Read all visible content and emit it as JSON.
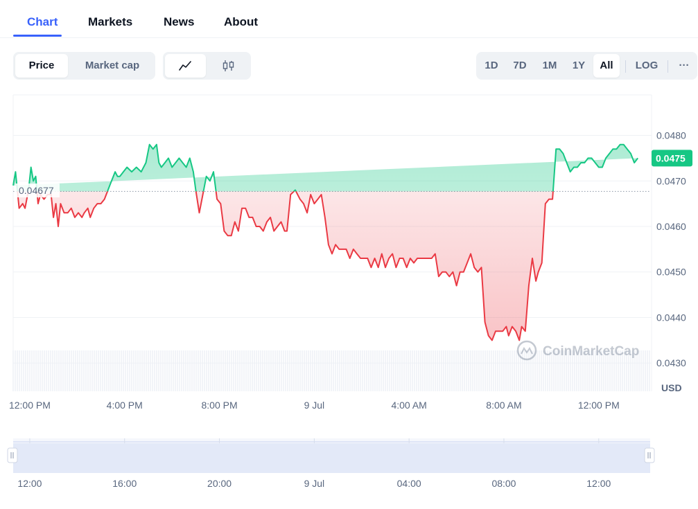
{
  "tabs": [
    {
      "label": "Chart",
      "active": true
    },
    {
      "label": "Markets",
      "active": false
    },
    {
      "label": "News",
      "active": false
    },
    {
      "label": "About",
      "active": false
    }
  ],
  "controls": {
    "metric": {
      "price": "Price",
      "market_cap": "Market cap",
      "selected": "Price"
    },
    "chart_style": {
      "line_icon": "line-chart-icon",
      "candle_icon": "candlestick-icon",
      "selected": "line"
    },
    "ranges": [
      "1D",
      "7D",
      "1M",
      "1Y",
      "All"
    ],
    "selected_range": "All",
    "log_label": "LOG",
    "more_label": "···"
  },
  "colors": {
    "up": "#16c784",
    "down": "#ea3943",
    "accent": "#3861fb"
  },
  "watermark": "CoinMarketCap",
  "currency": "USD",
  "chart_data": {
    "type": "line",
    "baseline_label": "0.04677",
    "baseline": 0.04677,
    "current_price_label": "0.0475",
    "y_ticks": [
      "0.0480",
      "0.0470",
      "0.0460",
      "0.0450",
      "0.0440",
      "0.0430"
    ],
    "ylim": [
      0.04238,
      0.04889
    ],
    "x_ticks": [
      "12:00 PM",
      "4:00 PM",
      "8:00 PM",
      "9 Jul",
      "4:00 AM",
      "8:00 AM",
      "12:00 PM"
    ],
    "x_tick_hours": [
      0,
      4,
      8,
      12,
      16,
      20,
      24
    ],
    "xlim_hours": [
      -0.7,
      26.17
    ],
    "navigator_ticks": [
      "12:00",
      "16:00",
      "20:00",
      "9 Jul",
      "04:00",
      "08:00",
      "12:00"
    ],
    "series": [
      {
        "hours": [
          -0.7,
          -0.6,
          -0.45,
          -0.3,
          -0.2,
          -0.05,
          0.05,
          0.15,
          0.25,
          0.35,
          0.45,
          0.6,
          0.75,
          0.9,
          1.0,
          1.1,
          1.2,
          1.3,
          1.45,
          1.6,
          1.75,
          1.9,
          2.05,
          2.2,
          2.3,
          2.45,
          2.55,
          2.7,
          2.85,
          3.0,
          3.15,
          3.3,
          3.45,
          3.6,
          3.7,
          3.8,
          3.95,
          4.1,
          4.3,
          4.5,
          4.7,
          4.9,
          5.05,
          5.2,
          5.35,
          5.45,
          5.55,
          5.7,
          5.85,
          6.0,
          6.15,
          6.3,
          6.45,
          6.6,
          6.75,
          6.9,
          7.0,
          7.15,
          7.3,
          7.45,
          7.6,
          7.75,
          7.9,
          8.05,
          8.2,
          8.35,
          8.5,
          8.65,
          8.8,
          8.95,
          9.1,
          9.25,
          9.4,
          9.55,
          9.7,
          9.85,
          10.0,
          10.15,
          10.3,
          10.45,
          10.6,
          10.75,
          10.85,
          11.0,
          11.2,
          11.4,
          11.55,
          11.7,
          11.85,
          12.0,
          12.15,
          12.3,
          12.45,
          12.6,
          12.75,
          12.9,
          13.05,
          13.2,
          13.35,
          13.5,
          13.65,
          13.8,
          13.95,
          14.1,
          14.25,
          14.4,
          14.55,
          14.7,
          14.85,
          15.0,
          15.15,
          15.3,
          15.45,
          15.6,
          15.75,
          15.9,
          16.05,
          16.2,
          16.35,
          16.5,
          16.65,
          16.8,
          16.95,
          17.1,
          17.25,
          17.4,
          17.55,
          17.7,
          17.85,
          18.0,
          18.15,
          18.3,
          18.45,
          18.6,
          18.75,
          18.9,
          19.05,
          19.2,
          19.35,
          19.5,
          19.65,
          19.8,
          19.95,
          20.1,
          20.2,
          20.35,
          20.5,
          20.65,
          20.75,
          20.9,
          21.05,
          21.2,
          21.35,
          21.45,
          21.6,
          21.75,
          21.9,
          22.05,
          22.2,
          22.35,
          22.5,
          22.65,
          22.8,
          22.95,
          23.1,
          23.25,
          23.4,
          23.55,
          23.7,
          23.85,
          24.0,
          24.15,
          24.3,
          24.45,
          24.6,
          24.75,
          24.9,
          25.05,
          25.2,
          25.35,
          25.5,
          25.65,
          25.8,
          25.95,
          26.17
        ],
        "values": [
          0.0469,
          0.0472,
          0.0464,
          0.0465,
          0.0464,
          0.0468,
          0.0473,
          0.047,
          0.0471,
          0.0465,
          0.0467,
          0.0466,
          0.0467,
          0.0467,
          0.0462,
          0.0465,
          0.046,
          0.0465,
          0.0463,
          0.0463,
          0.0464,
          0.0462,
          0.0463,
          0.0462,
          0.0463,
          0.0464,
          0.0462,
          0.0464,
          0.0465,
          0.0465,
          0.0466,
          0.0468,
          0.047,
          0.0472,
          0.0471,
          0.0471,
          0.0472,
          0.0473,
          0.0472,
          0.0473,
          0.0472,
          0.0474,
          0.0478,
          0.0477,
          0.0478,
          0.0474,
          0.0473,
          0.0474,
          0.0475,
          0.0473,
          0.0474,
          0.0475,
          0.0474,
          0.0473,
          0.0475,
          0.0472,
          0.0468,
          0.0463,
          0.0467,
          0.0471,
          0.047,
          0.0472,
          0.0466,
          0.0465,
          0.0459,
          0.0458,
          0.0458,
          0.0461,
          0.0459,
          0.0464,
          0.0464,
          0.0462,
          0.0462,
          0.046,
          0.046,
          0.0459,
          0.0461,
          0.0462,
          0.0459,
          0.046,
          0.0461,
          0.0459,
          0.0459,
          0.0467,
          0.0468,
          0.0466,
          0.0465,
          0.0463,
          0.0467,
          0.0465,
          0.0466,
          0.0467,
          0.0462,
          0.0456,
          0.0454,
          0.0456,
          0.0455,
          0.0455,
          0.0455,
          0.0453,
          0.0455,
          0.0454,
          0.0453,
          0.0453,
          0.0453,
          0.0451,
          0.0453,
          0.0451,
          0.0454,
          0.0451,
          0.0453,
          0.0454,
          0.0451,
          0.0453,
          0.0453,
          0.0451,
          0.0453,
          0.0452,
          0.0453,
          0.0453,
          0.0453,
          0.0453,
          0.0453,
          0.0454,
          0.0449,
          0.045,
          0.045,
          0.0449,
          0.045,
          0.0447,
          0.045,
          0.045,
          0.0452,
          0.0454,
          0.0451,
          0.045,
          0.0451,
          0.0439,
          0.0436,
          0.0435,
          0.0437,
          0.0437,
          0.0437,
          0.0438,
          0.0436,
          0.0438,
          0.0437,
          0.0435,
          0.0438,
          0.0437,
          0.0447,
          0.0453,
          0.0448,
          0.045,
          0.0452,
          0.0465,
          0.0466,
          0.0466,
          0.0477,
          0.0477,
          0.0476,
          0.0474,
          0.0472,
          0.0473,
          0.0473,
          0.0474,
          0.0474,
          0.0475,
          0.0475,
          0.0474,
          0.0473,
          0.0473,
          0.0475,
          0.0476,
          0.0477,
          0.0477,
          0.0478,
          0.0478,
          0.0477,
          0.0476,
          0.0474,
          0.0475
        ]
      }
    ]
  }
}
